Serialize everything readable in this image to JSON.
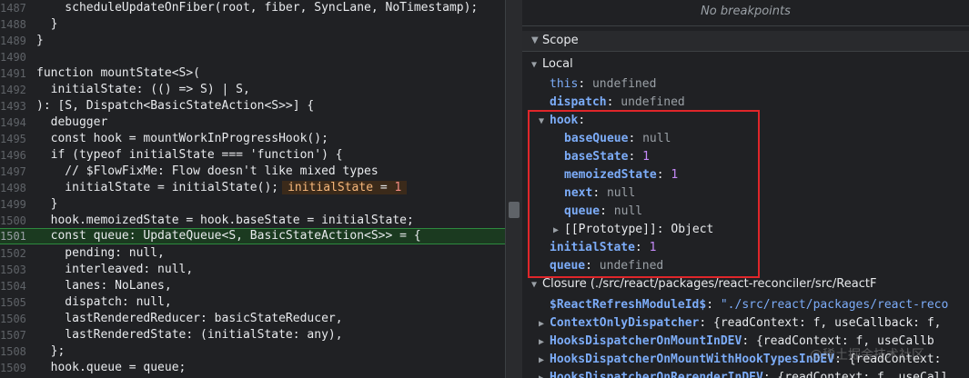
{
  "code_lines": [
    {
      "ln": "1487",
      "src": "    scheduleUpdateOnFiber(root, fiber, SyncLane, NoTimestamp);"
    },
    {
      "ln": "1488",
      "src": "  }"
    },
    {
      "ln": "1489",
      "src": "}"
    },
    {
      "ln": "1490",
      "src": ""
    },
    {
      "ln": "1491",
      "src": "function mountState<S>("
    },
    {
      "ln": "1492",
      "src": "  initialState: (() => S) | S,"
    },
    {
      "ln": "1493",
      "src": "): [S, Dispatch<BasicStateAction<S>>] {"
    },
    {
      "ln": "1494",
      "src": "  debugger"
    },
    {
      "ln": "1495",
      "src": "  const hook = mountWorkInProgressHook();"
    },
    {
      "ln": "1496",
      "src": "  if (typeof initialState === 'function') {"
    },
    {
      "ln": "1497",
      "src": "    // $FlowFixMe: Flow doesn't like mixed types"
    },
    {
      "ln": "1498",
      "src": "    initialState = initialState();"
    },
    {
      "ln": "1499",
      "src": "  }"
    },
    {
      "ln": "1500",
      "src": "  hook.memoizedState = hook.baseState = initialState;"
    },
    {
      "ln": "1501",
      "src": "  const queue: UpdateQueue<S, BasicStateAction<S>> = {"
    },
    {
      "ln": "1502",
      "src": "    pending: null,"
    },
    {
      "ln": "1503",
      "src": "    interleaved: null,"
    },
    {
      "ln": "1504",
      "src": "    lanes: NoLanes,"
    },
    {
      "ln": "1505",
      "src": "    dispatch: null,"
    },
    {
      "ln": "1506",
      "src": "    lastRenderedReducer: basicStateReducer,"
    },
    {
      "ln": "1507",
      "src": "    lastRenderedState: (initialState: any),"
    },
    {
      "ln": "1508",
      "src": "  };"
    },
    {
      "ln": "1509",
      "src": "  hook.queue = queue;"
    }
  ],
  "inline_value": {
    "name": "initialState",
    "eq": " = ",
    "value": "1"
  },
  "breakpoints": {
    "empty_text": "No breakpoints"
  },
  "scope": {
    "header": "Scope",
    "local_label": "Local",
    "this": {
      "name": "this",
      "value": "undefined"
    },
    "dispatch": {
      "name": "dispatch",
      "value": "undefined"
    },
    "hook": {
      "name": "hook"
    },
    "baseQueue": {
      "name": "baseQueue",
      "value": "null"
    },
    "baseState": {
      "name": "baseState",
      "value": "1"
    },
    "memoizedState": {
      "name": "memoizedState",
      "value": "1"
    },
    "next": {
      "name": "next",
      "value": "null"
    },
    "queue_inner": {
      "name": "queue",
      "value": "null"
    },
    "prototype": {
      "name": "[[Prototype]]",
      "value": "Object"
    },
    "initialState": {
      "name": "initialState",
      "value": "1"
    },
    "queue": {
      "name": "queue",
      "value": "undefined"
    },
    "closure_label": "Closure (./src/react/packages/react-reconciler/src/ReactF",
    "refresh_id": {
      "name": "$ReactRefreshModuleId$",
      "value": "\"./src/react/packages/react-reco"
    },
    "ctx_dispatcher": {
      "name": "ContextOnlyDispatcher",
      "value": "{readContext: f, useCallback: f,"
    },
    "mount_dev": {
      "name": "HooksDispatcherOnMountInDEV",
      "value": "{readContext: f, useCallb"
    },
    "mount_hook_types": {
      "name": "HooksDispatcherOnMountWithHookTypesInDEV",
      "value": "{readContext:"
    },
    "rerender_dev": {
      "name": "HooksDispatcherOnRerenderInDEV",
      "value": "{readContext: f, useCall"
    }
  },
  "watermark": "@稀土掘金技术社区",
  "colors": {
    "highlight_box": "#e0262a",
    "exec_line": "#1b3a20"
  }
}
